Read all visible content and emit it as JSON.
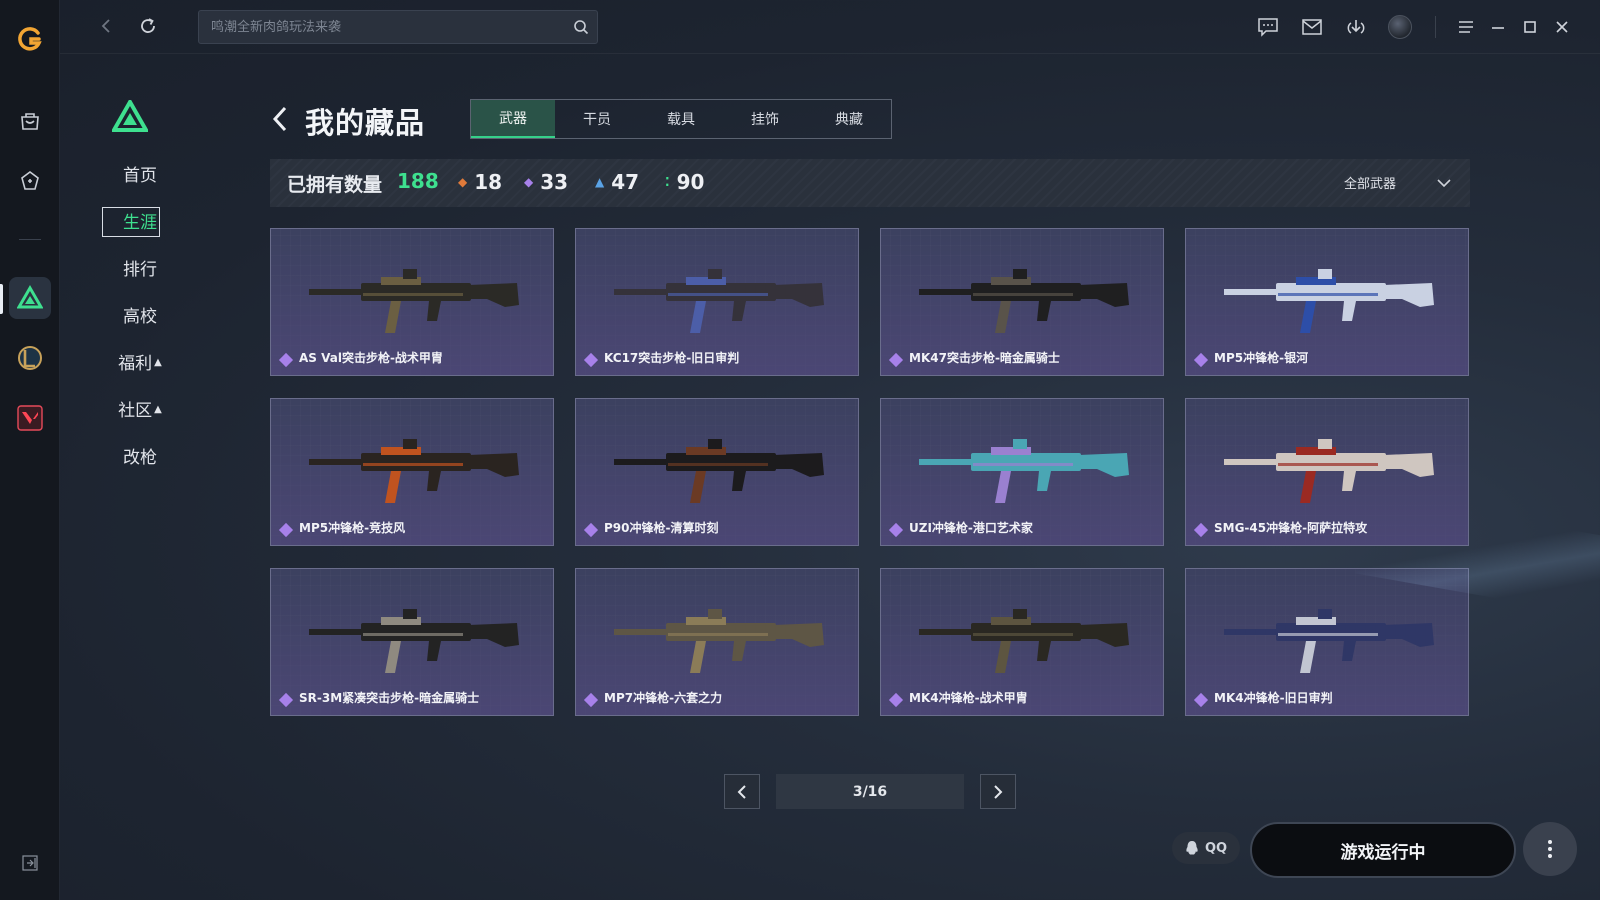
{
  "search": {
    "placeholder": "鸣潮全新肉鸽玩法来袭"
  },
  "subnav": {
    "items": [
      {
        "label": "首页"
      },
      {
        "label": "生涯"
      },
      {
        "label": "排行"
      },
      {
        "label": "高校"
      },
      {
        "label": "福利"
      },
      {
        "label": "社区"
      },
      {
        "label": "改枪"
      }
    ]
  },
  "page": {
    "title": "我的藏品"
  },
  "tabs": [
    {
      "label": "武器"
    },
    {
      "label": "干员"
    },
    {
      "label": "载具"
    },
    {
      "label": "挂饰"
    },
    {
      "label": "典藏"
    }
  ],
  "stats": {
    "owned_label": "已拥有数量",
    "owned_total": "188",
    "rarity_counts": [
      {
        "value": "18",
        "color": "#e07a3a"
      },
      {
        "value": "33",
        "color": "#a781ea"
      },
      {
        "value": "47",
        "color": "#5aa3e6"
      },
      {
        "value": "90",
        "color": "#3ee08f"
      }
    ],
    "filter_label": "全部武器"
  },
  "items": [
    {
      "name": "AS Val突击步枪-战术甲胄",
      "gun_color": "#2b2a26",
      "accent": "#6b5f42"
    },
    {
      "name": "KC17突击步枪-旧日审判",
      "gun_color": "#35323a",
      "accent": "#4c5ea8"
    },
    {
      "name": "MK47突击步枪-暗金属骑士",
      "gun_color": "#1f1f20",
      "accent": "#59534a"
    },
    {
      "name": "MP5冲锋枪-银河",
      "gun_color": "#c9d1e2",
      "accent": "#2d4ea8"
    },
    {
      "name": "MP5冲锋枪-竞技风",
      "gun_color": "#2a2420",
      "accent": "#c0531f"
    },
    {
      "name": "P90冲锋枪-清算时刻",
      "gun_color": "#1c1b1d",
      "accent": "#6b3a24"
    },
    {
      "name": "UZI冲锋枪-港口艺术家",
      "gun_color": "#4aa6b4",
      "accent": "#9a80d0"
    },
    {
      "name": "SMG-45冲锋枪-阿萨拉特攻",
      "gun_color": "#cfc6c0",
      "accent": "#9a2a22"
    },
    {
      "name": "SR-3M紧凑突击步枪-暗金属骑士",
      "gun_color": "#232323",
      "accent": "#8f8a80"
    },
    {
      "name": "MP7冲锋枪-六套之力",
      "gun_color": "#5e5645",
      "accent": "#8b7c58"
    },
    {
      "name": "MK4冲锋枪-战术甲胄",
      "gun_color": "#2a2822",
      "accent": "#5d5540"
    },
    {
      "name": "MK4冲锋枪-旧日审判",
      "gun_color": "#2f3766",
      "accent": "#c2c6d2"
    }
  ],
  "pagination": {
    "current": "3/16"
  },
  "footer": {
    "qq_label": "QQ",
    "play_label": "游戏运行中"
  }
}
